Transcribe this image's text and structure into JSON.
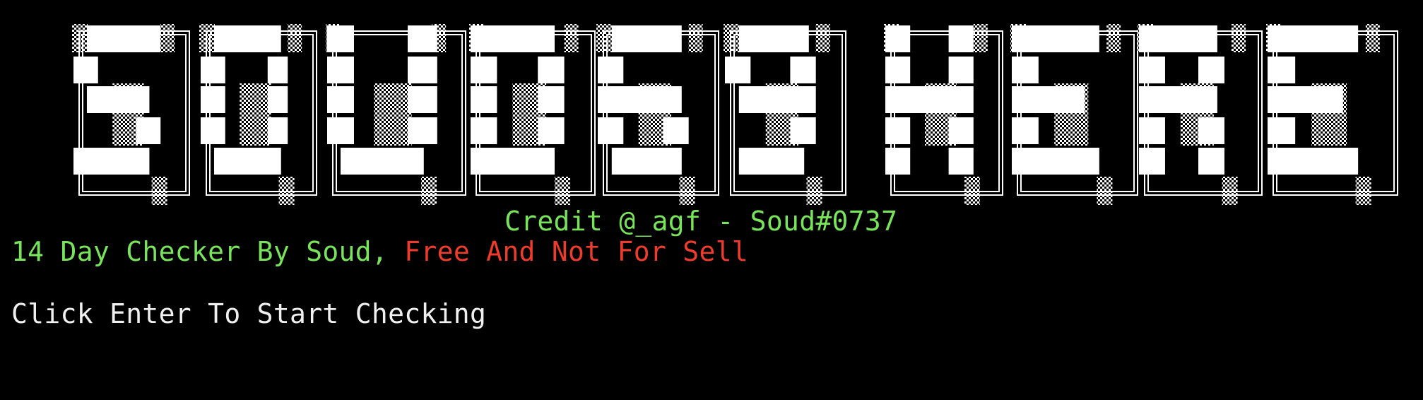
{
  "terminal": {
    "background": "#000000",
    "banner": {
      "art_name": "ascii-art-banner",
      "color": "#ffffff"
    },
    "credit": "Credit @_agf - Soud#0737",
    "info_line": {
      "part1": "14 Day Checker By Soud, ",
      "part2": "Free And Not For Sell"
    },
    "prompt": "Click Enter To Start Checking",
    "colors": {
      "green": "#78e45a",
      "red": "#ee3b2c",
      "white": "#f0f0f0"
    }
  }
}
